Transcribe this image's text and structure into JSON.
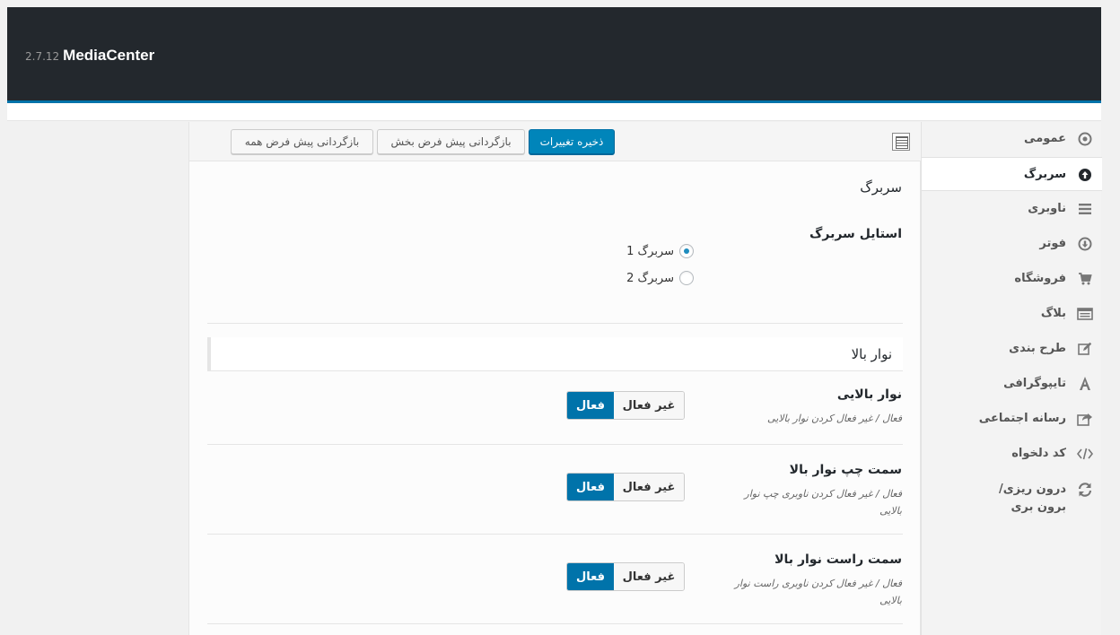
{
  "header": {
    "brand": "MediaCenter",
    "version": "2.7.12"
  },
  "toolbar": {
    "save": "ذخیره تغییرات",
    "reset_section": "بازگردانی پیش فرض بخش",
    "reset_all": "بازگردانی پیش فرض همه"
  },
  "sidebar": {
    "items": [
      {
        "label": "عمومی",
        "icon": "target-icon"
      },
      {
        "label": "سربرگ",
        "icon": "arrow-up-circle-icon"
      },
      {
        "label": "ناوبری",
        "icon": "menu-icon"
      },
      {
        "label": "فوتر",
        "icon": "arrow-down-circle-icon"
      },
      {
        "label": "فروشگاه",
        "icon": "cart-icon"
      },
      {
        "label": "بلاگ",
        "icon": "list-icon"
      },
      {
        "label": "طرح بندی",
        "icon": "edit-icon"
      },
      {
        "label": "تایپوگرافی",
        "icon": "letter-a-icon"
      },
      {
        "label": "رسانه اجتماعی",
        "icon": "share-icon"
      },
      {
        "label": "کد دلخواه",
        "icon": "code-icon"
      },
      {
        "label": "درون ریزی/ برون بری",
        "icon": "refresh-icon"
      }
    ]
  },
  "main": {
    "section_title": "سربرگ",
    "header_style": {
      "label": "استایل سربرگ",
      "options": [
        "سربرگ 1",
        "سربرگ 2"
      ],
      "selected": "سربرگ 1"
    },
    "topbar": {
      "title": "نوار بالا",
      "on_label": "فعال",
      "off_label": "غیر فعال",
      "fields": [
        {
          "title": "نوار بالایی",
          "desc": "فعال / غیر فعال کردن نوار بالایی",
          "value": "فعال"
        },
        {
          "title": "سمت چپ نوار بالا",
          "desc": "فعال / غیر فعال کردن ناوبری چپ نوار بالایی",
          "value": "فعال"
        },
        {
          "title": "سمت راست نوار بالا",
          "desc": "فعال / غیر فعال کردن ناوبری راست نوار بالایی",
          "value": "فعال"
        }
      ]
    }
  }
}
